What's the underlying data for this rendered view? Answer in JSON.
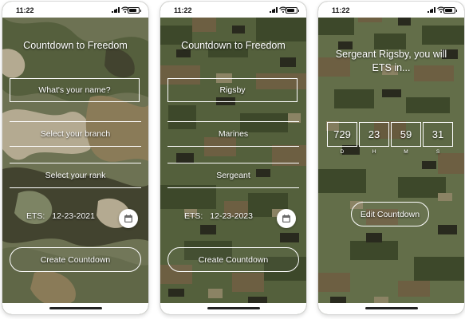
{
  "status_bar": {
    "time": "11:22"
  },
  "screens": [
    {
      "title": "Countdown to Freedom",
      "name_field": {
        "placeholder": "What's your name?"
      },
      "branch_field": {
        "placeholder": "Select your branch"
      },
      "rank_field": {
        "placeholder": "Select your rank"
      },
      "ets": {
        "label": "ETS:",
        "date": "12-23-2021"
      },
      "calendar_icon": "calendar-icon",
      "primary_button": "Create Countdown"
    },
    {
      "title": "Countdown to Freedom",
      "name_field": {
        "value": "Rigsby"
      },
      "branch_field": {
        "value": "Marines"
      },
      "rank_field": {
        "value": "Sergeant"
      },
      "ets": {
        "label": "ETS:",
        "date": "12-23-2023"
      },
      "calendar_icon": "calendar-icon",
      "primary_button": "Create Countdown"
    },
    {
      "title_line1": "Sergeant Rigsby, you will",
      "title_line2": "ETS in...",
      "countdown": [
        {
          "value": "729",
          "unit": "D"
        },
        {
          "value": "23",
          "unit": "H"
        },
        {
          "value": "59",
          "unit": "M"
        },
        {
          "value": "31",
          "unit": "S"
        }
      ],
      "edit_button": "Edit Countdown"
    }
  ],
  "colors": {
    "text": "#ffffff",
    "multicam": [
      "#7a7f5d",
      "#5f6a45",
      "#9a8a62",
      "#c9bea2",
      "#4a4b35",
      "#8c9370"
    ],
    "marpat": [
      "#5e6b43",
      "#45512f",
      "#7a6a4a",
      "#2e2f22",
      "#9b9270",
      "#6f7b52"
    ]
  }
}
